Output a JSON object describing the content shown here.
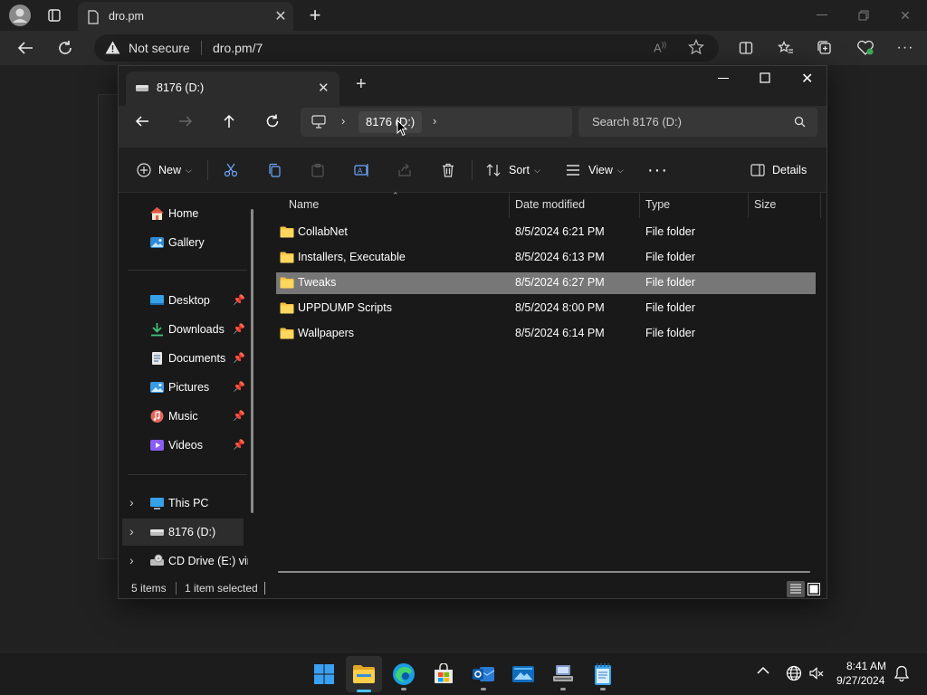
{
  "browser": {
    "tab_title": "dro.pm",
    "security_label": "Not secure",
    "url": "dro.pm/7"
  },
  "explorer": {
    "tab_title": "8176 (D:)",
    "breadcrumb_item": "8176 (D:)",
    "search_placeholder": "Search 8176 (D:)",
    "commands": {
      "new": "New",
      "sort": "Sort",
      "view": "View",
      "details": "Details"
    },
    "sidebar": {
      "quick": [
        {
          "label": "Home",
          "icon": "home-icon"
        },
        {
          "label": "Gallery",
          "icon": "gallery-icon"
        }
      ],
      "pinned": [
        {
          "label": "Desktop",
          "icon": "desktop-icon"
        },
        {
          "label": "Downloads",
          "icon": "downloads-icon"
        },
        {
          "label": "Documents",
          "icon": "documents-icon"
        },
        {
          "label": "Pictures",
          "icon": "pictures-icon"
        },
        {
          "label": "Music",
          "icon": "music-icon"
        },
        {
          "label": "Videos",
          "icon": "videos-icon"
        }
      ],
      "drives": [
        {
          "label": "This PC",
          "icon": "pc-icon"
        },
        {
          "label": "8176 (D:)",
          "icon": "drive-icon"
        },
        {
          "label": "CD Drive (E:) virt",
          "icon": "cd-drive-icon"
        }
      ]
    },
    "columns": {
      "name": "Name",
      "date": "Date modified",
      "type": "Type",
      "size": "Size"
    },
    "files": [
      {
        "name": "CollabNet",
        "date": "8/5/2024 6:21 PM",
        "type": "File folder",
        "size": ""
      },
      {
        "name": "Installers, Executable",
        "date": "8/5/2024 6:13 PM",
        "type": "File folder",
        "size": ""
      },
      {
        "name": "Tweaks",
        "date": "8/5/2024 6:27 PM",
        "type": "File folder",
        "size": ""
      },
      {
        "name": "UPPDUMP Scripts",
        "date": "8/5/2024 8:00 PM",
        "type": "File folder",
        "size": ""
      },
      {
        "name": "Wallpapers",
        "date": "8/5/2024 6:14 PM",
        "type": "File folder",
        "size": ""
      }
    ],
    "status": {
      "count": "5 items",
      "selection": "1 item selected"
    }
  },
  "taskbar": {
    "time": "8:41 AM",
    "date": "9/27/2024"
  },
  "colors": {
    "folder": "#f5c242",
    "selected_row": "#777777",
    "accent": "#4cc2ff"
  }
}
